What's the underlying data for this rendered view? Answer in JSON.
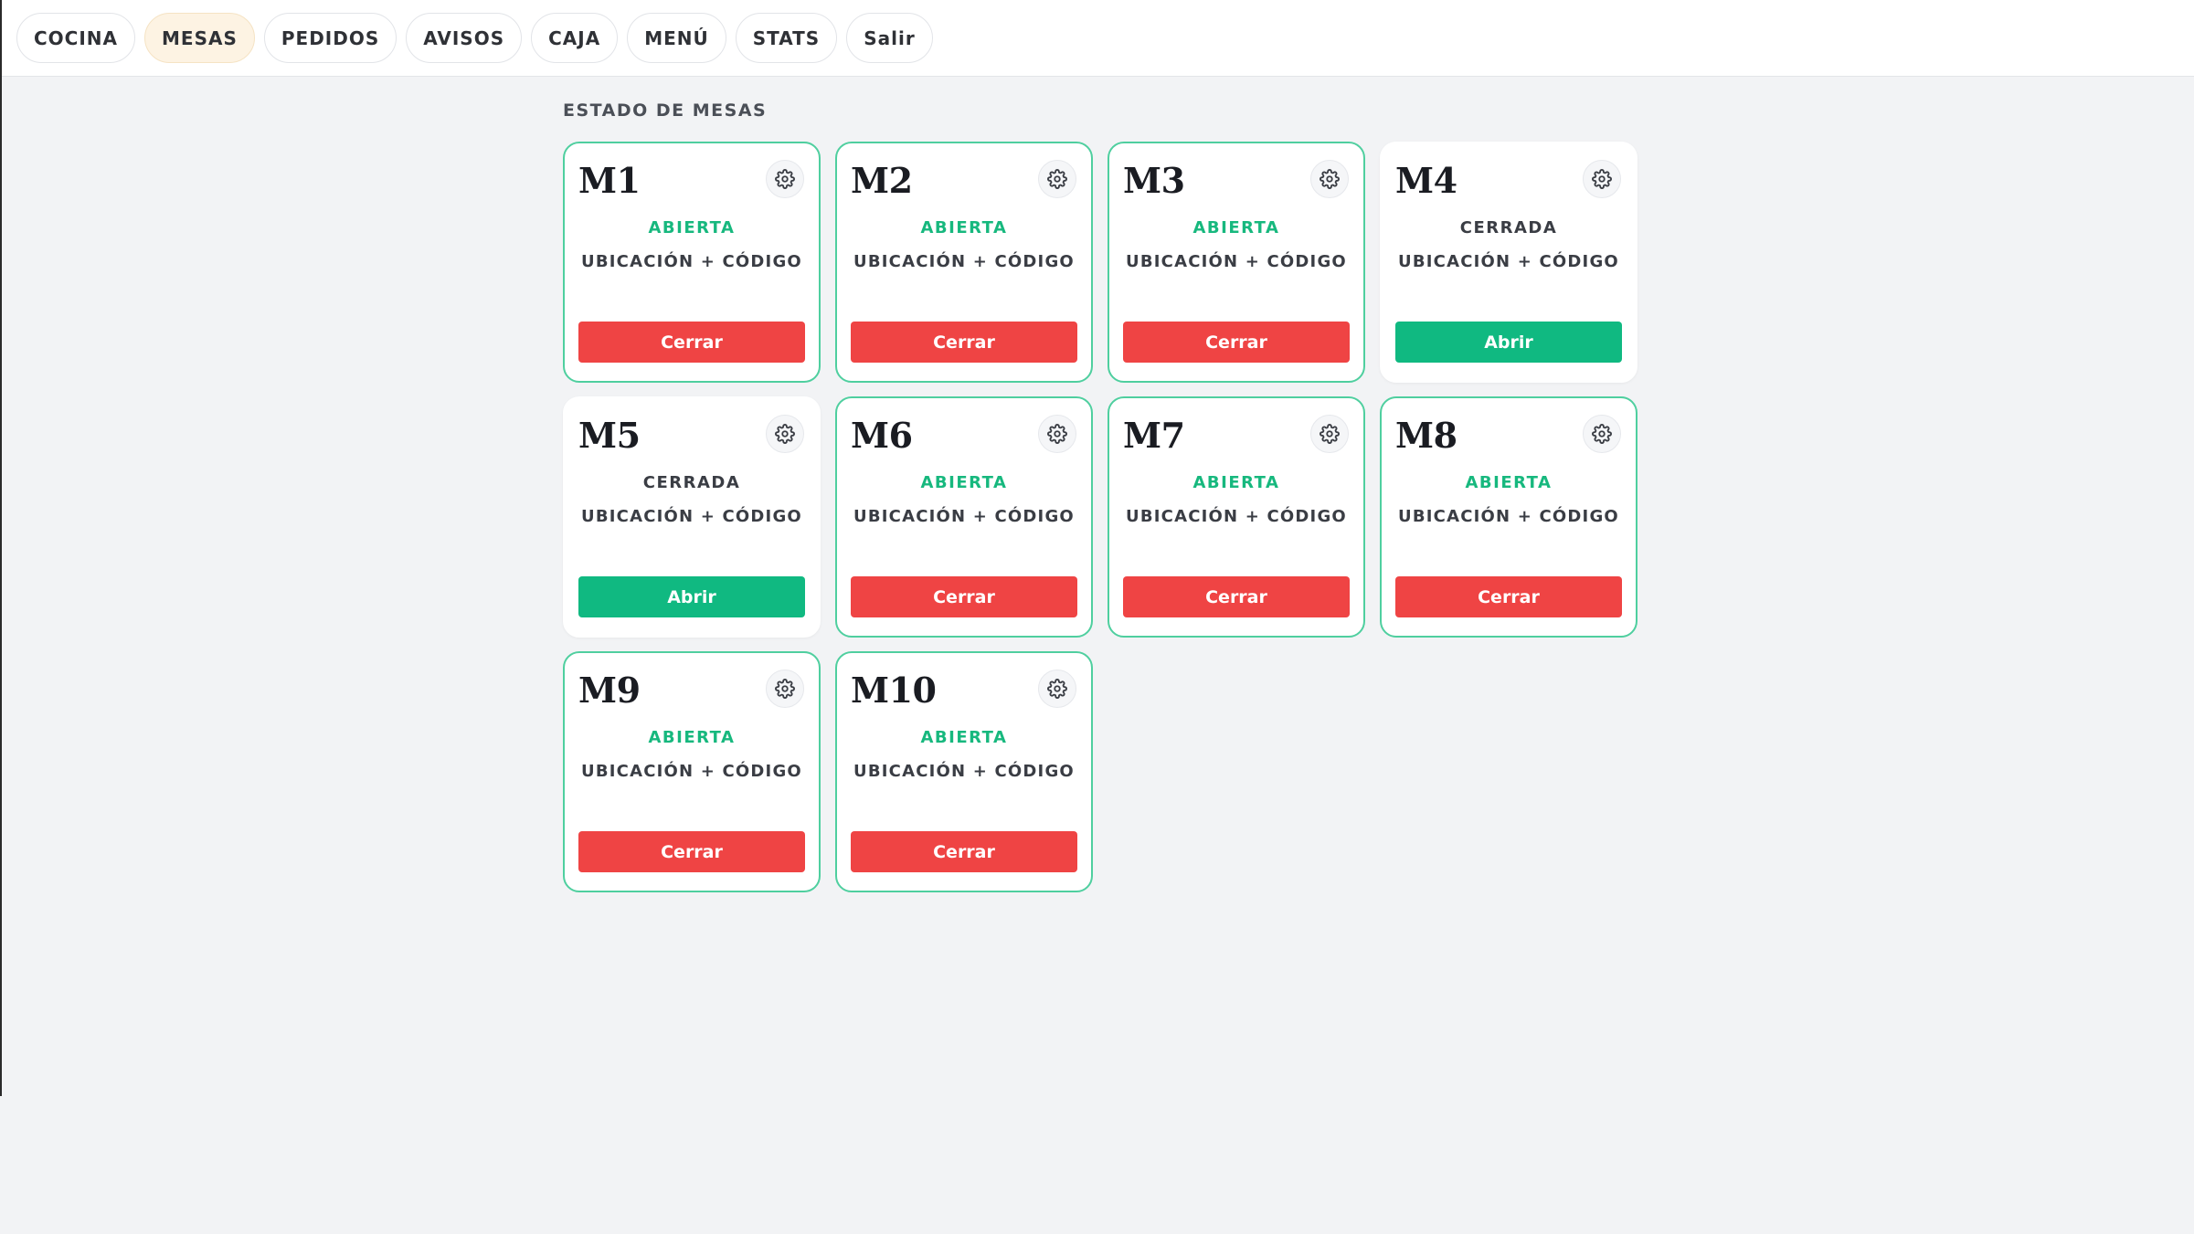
{
  "nav": {
    "items": [
      {
        "label": "COCINA",
        "active": false
      },
      {
        "label": "MESAS",
        "active": true
      },
      {
        "label": "PEDIDOS",
        "active": false
      },
      {
        "label": "AVISOS",
        "active": false
      },
      {
        "label": "CAJA",
        "active": false
      },
      {
        "label": "MENÚ",
        "active": false
      },
      {
        "label": "STATS",
        "active": false
      },
      {
        "label": "Salir",
        "active": false
      }
    ]
  },
  "section_title": "ESTADO DE MESAS",
  "icons": {
    "settings": "gear-icon"
  },
  "colors": {
    "open_status": "#17b87e",
    "open_border": "#4fcf9f",
    "close_button": "#ef4444",
    "open_button": "#10b981",
    "active_nav": "#fdf3e3"
  },
  "tables": [
    {
      "name": "M1",
      "status": "ABIERTA",
      "open": true,
      "location": "UBICACIÓN + CÓDIGO",
      "action": "Cerrar"
    },
    {
      "name": "M2",
      "status": "ABIERTA",
      "open": true,
      "location": "UBICACIÓN + CÓDIGO",
      "action": "Cerrar"
    },
    {
      "name": "M3",
      "status": "ABIERTA",
      "open": true,
      "location": "UBICACIÓN + CÓDIGO",
      "action": "Cerrar"
    },
    {
      "name": "M4",
      "status": "CERRADA",
      "open": false,
      "location": "UBICACIÓN + CÓDIGO",
      "action": "Abrir"
    },
    {
      "name": "M5",
      "status": "CERRADA",
      "open": false,
      "location": "UBICACIÓN + CÓDIGO",
      "action": "Abrir"
    },
    {
      "name": "M6",
      "status": "ABIERTA",
      "open": true,
      "location": "UBICACIÓN + CÓDIGO",
      "action": "Cerrar"
    },
    {
      "name": "M7",
      "status": "ABIERTA",
      "open": true,
      "location": "UBICACIÓN + CÓDIGO",
      "action": "Cerrar"
    },
    {
      "name": "M8",
      "status": "ABIERTA",
      "open": true,
      "location": "UBICACIÓN + CÓDIGO",
      "action": "Cerrar"
    },
    {
      "name": "M9",
      "status": "ABIERTA",
      "open": true,
      "location": "UBICACIÓN + CÓDIGO",
      "action": "Cerrar"
    },
    {
      "name": "M10",
      "status": "ABIERTA",
      "open": true,
      "location": "UBICACIÓN + CÓDIGO",
      "action": "Cerrar"
    }
  ]
}
